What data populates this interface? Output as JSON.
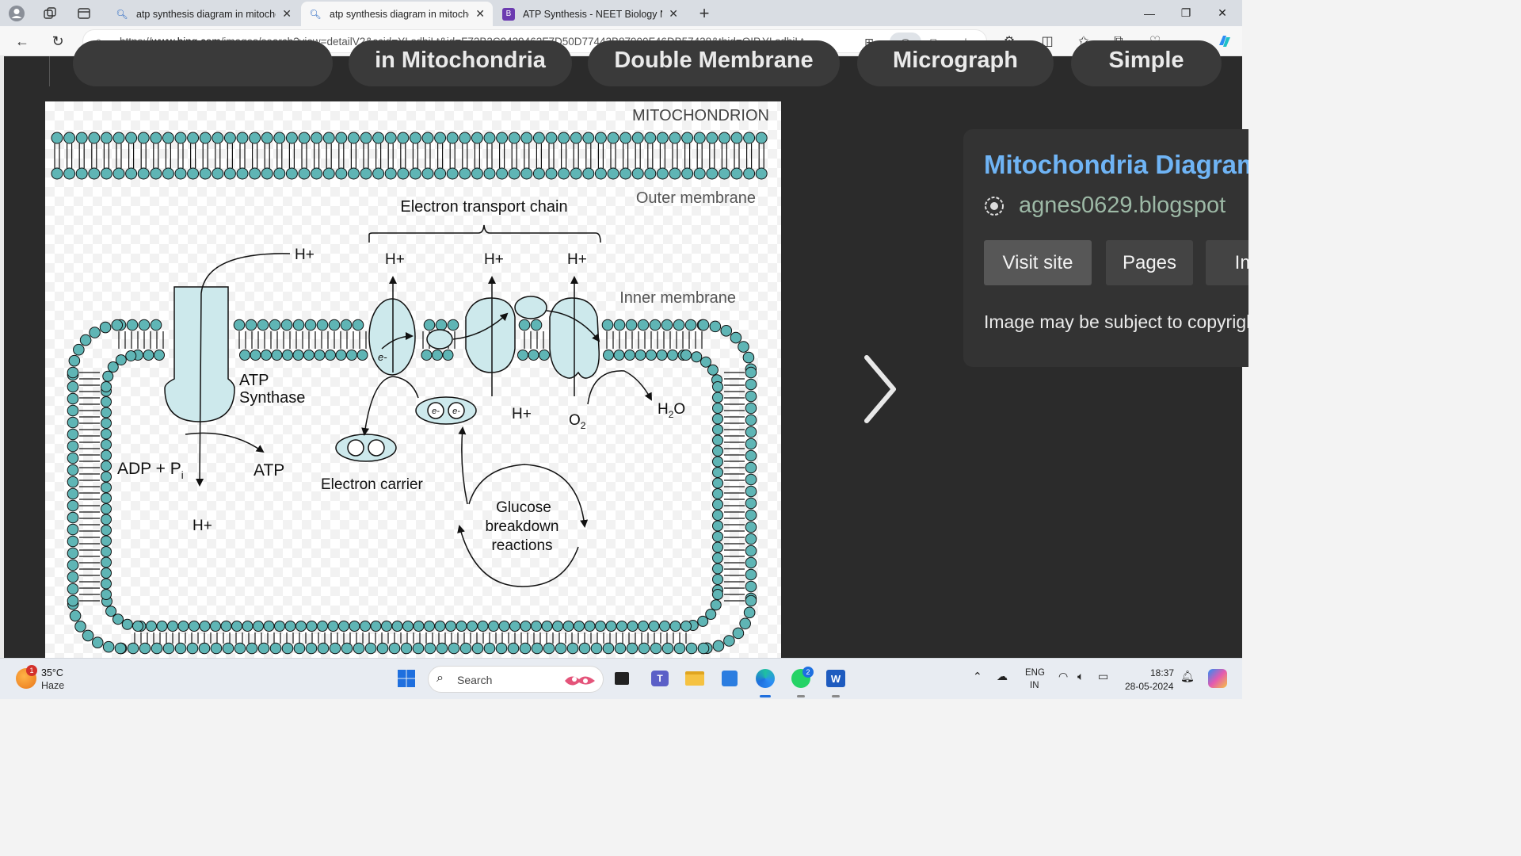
{
  "browser": {
    "tabs": [
      {
        "title": "atp synthesis diagram in mitocho",
        "active": false
      },
      {
        "title": "atp synthesis diagram in mitocho",
        "active": true
      },
      {
        "title": "ATP Synthesis - NEET Biology No",
        "active": false
      }
    ],
    "url_prefix": "https://",
    "url_host": "www.bing.com",
    "url_rest": "/images/search?view=detailV2&ccid=YLsdbiLt&id=F72B3C0429462F7D50D77443B87900F46DB57438&thid=OIP.YLsdbiLt..."
  },
  "related_searches": [
    {
      "label": ""
    },
    {
      "label": "in Mitochondria"
    },
    {
      "label": "Double Membrane"
    },
    {
      "label": "Micrograph"
    },
    {
      "label": "Simple"
    }
  ],
  "diagram": {
    "title": "MITOCHONDRION",
    "outer_membrane": "Outer membrane",
    "inner_membrane": "Inner membrane",
    "etc": "Electron transport chain",
    "h_plus": "H+",
    "atp_synthase_1": "ATP",
    "atp_synthase_2": "Synthase",
    "adp": "ADP + P",
    "adp_sub": "i",
    "atp": "ATP",
    "electron_carrier": "Electron carrier",
    "electron": "e-",
    "o2": "O",
    "o2_sub": "2",
    "h2o_h": "H",
    "h2o_sub": "2",
    "h2o_o": "O",
    "glucose_1": "Glucose",
    "glucose_2": "breakdown",
    "glucose_3": "reactions"
  },
  "info_panel": {
    "title": "Mitochondria Diagram",
    "site": "agnes0629.blogspot",
    "buttons": [
      "Visit site",
      "Pages",
      "Im"
    ],
    "copyright": "Image may be subject to copyright"
  },
  "taskbar": {
    "weather_badge": "1",
    "temp": "35°C",
    "weather": "Haze",
    "search_label": "Search",
    "teams_label": "T",
    "whatsapp_badge": "2",
    "word_label": "W",
    "lang_1": "ENG",
    "lang_2": "IN",
    "time": "18:37",
    "date": "28-05-2024"
  },
  "colors": {
    "membrane_fill": "#5fb5b5",
    "protein_fill": "#cde9ec",
    "info_title": "#6fb4f5",
    "info_site": "#9db9a6"
  }
}
